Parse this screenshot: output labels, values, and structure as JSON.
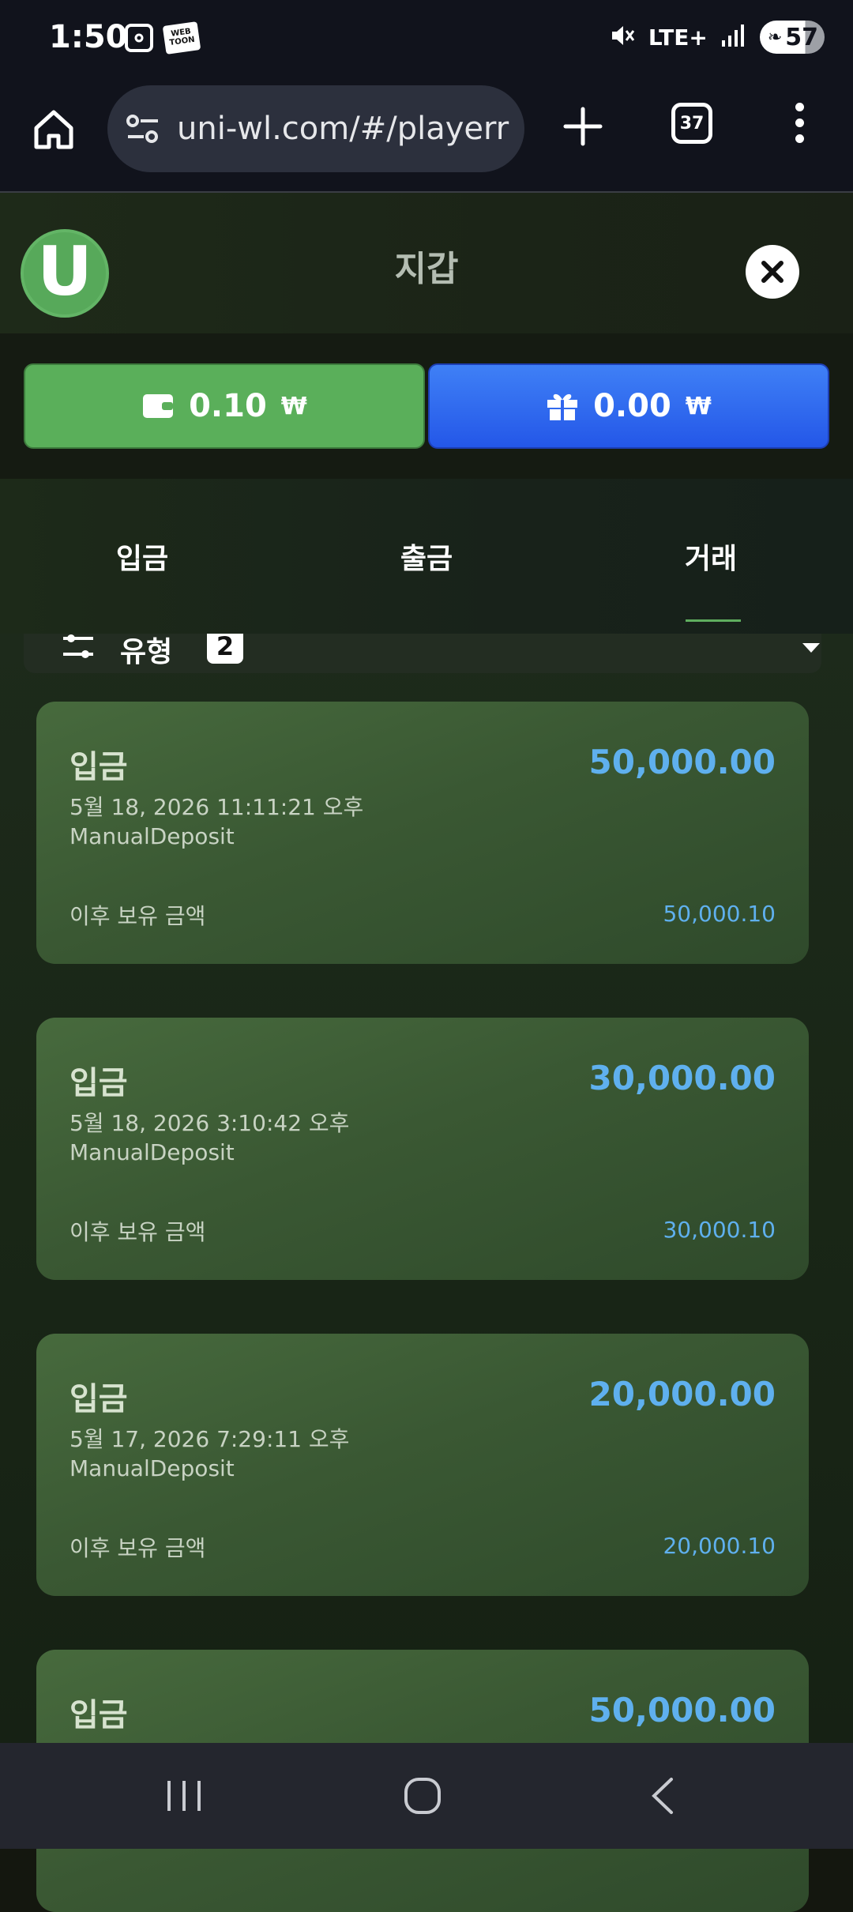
{
  "status_bar": {
    "time": "1:50",
    "webtoon_icon_text": "WEB TOON",
    "network": "LTE+",
    "battery": "57"
  },
  "browser": {
    "url": "uni-wl.com/#/playerr",
    "tab_count": "37"
  },
  "app": {
    "logo_letter": "U",
    "title": "지갑"
  },
  "balances": {
    "cash": {
      "amount": "0.10",
      "currency": "₩"
    },
    "bonus": {
      "amount": "0.00",
      "currency": "₩"
    }
  },
  "tabs": [
    {
      "label": "입금"
    },
    {
      "label": "출금"
    },
    {
      "label": "거래",
      "active": true
    }
  ],
  "filter": {
    "label": "유형",
    "count": "2"
  },
  "transactions": [
    {
      "type": "입금",
      "amount": "50,000.00",
      "date": "5월 18, 2026 11:11:21 오후",
      "method": "ManualDeposit",
      "after_label": "이후 보유 금액",
      "after_value": "50,000.10"
    },
    {
      "type": "입금",
      "amount": "30,000.00",
      "date": "5월 18, 2026 3:10:42 오후",
      "method": "ManualDeposit",
      "after_label": "이후 보유 금액",
      "after_value": "30,000.10"
    },
    {
      "type": "입금",
      "amount": "20,000.00",
      "date": "5월 17, 2026 7:29:11 오후",
      "method": "ManualDeposit",
      "after_label": "이후 보유 금액",
      "after_value": "20,000.10"
    },
    {
      "type": "입금",
      "amount": "50,000.00"
    }
  ],
  "colors": {
    "accent_green": "#5aaf5a",
    "accent_blue": "#2f6bf0",
    "amount_blue": "#5fb0ee"
  }
}
